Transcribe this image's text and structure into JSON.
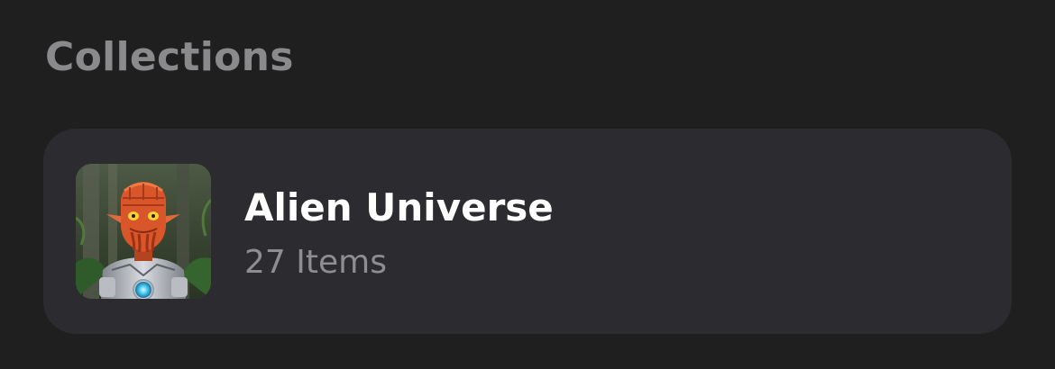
{
  "section": {
    "title": "Collections"
  },
  "collections": [
    {
      "name": "Alien Universe",
      "count_label": "27 Items",
      "thumbnail_icon": "alien-avatar-image"
    }
  ],
  "colors": {
    "background": "#1f1f20",
    "card": "#2c2c30",
    "title_text": "#8a8a8d",
    "primary_text": "#ffffff",
    "secondary_text": "#8d8d92"
  }
}
